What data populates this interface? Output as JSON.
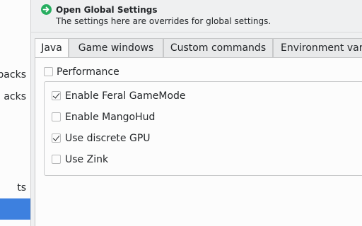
{
  "sidebar": {
    "items": [
      {
        "label": "packs"
      },
      {
        "label": "acks"
      },
      {
        "label": "ts"
      },
      {
        "label": ""
      }
    ]
  },
  "banner": {
    "title": "Open Global Settings",
    "subtitle": "The settings here are overrides for global settings.",
    "icon": "arrow-right-circle-icon",
    "icon_color": "#27ae60"
  },
  "tabs": [
    {
      "label": "Java"
    },
    {
      "label": "Game windows"
    },
    {
      "label": "Custom commands"
    },
    {
      "label": "Environment varia"
    }
  ],
  "performance": {
    "label": "Performance",
    "checked": false,
    "options": [
      {
        "label": "Enable Feral GameMode",
        "checked": true
      },
      {
        "label": "Enable MangoHud",
        "checked": false
      },
      {
        "label": "Use discrete GPU",
        "checked": true
      },
      {
        "label": "Use Zink",
        "checked": false
      }
    ]
  },
  "colors": {
    "selection": "#3d80df",
    "window_bg": "#eff0f1"
  }
}
